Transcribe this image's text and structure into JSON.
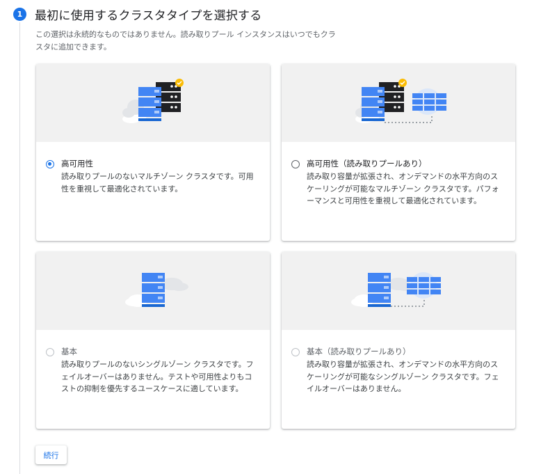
{
  "step": {
    "number": "1",
    "title": "最初に使用するクラスタタイプを選択する",
    "description": "この選択は永続的なものではありません。読み取りプール インスタンスはいつでもクラスタに追加できます。"
  },
  "options": [
    {
      "title": "高可用性",
      "description": "読み取りプールのないマルチゾーン クラスタです。可用性を重視して最適化されています。",
      "selected": true,
      "illustration": "multi-zone-cluster"
    },
    {
      "title": "高可用性（読み取りプールあり）",
      "description": "読み取り容量が拡張され、オンデマンドの水平方向のスケーリングが可能なマルチゾーン クラスタです。パフォーマンスと可用性を重視して最適化されています。",
      "selected": false,
      "illustration": "multi-zone-cluster-with-read-pool"
    },
    {
      "title": "基本",
      "description": "読み取りプールのないシングルゾーン クラスタです。フェイルオーバーはありません。テストや可用性よりもコストの抑制を優先するユースケースに適しています。",
      "selected": false,
      "illustration": "single-zone-cluster"
    },
    {
      "title": "基本（読み取りプールあり）",
      "description": "読み取り容量が拡張され、オンデマンドの水平方向のスケーリングが可能なシングルゾーン クラスタです。フェイルオーバーはありません。",
      "selected": false,
      "illustration": "single-zone-cluster-with-read-pool"
    }
  ],
  "actions": {
    "continue_label": "続行"
  },
  "colors": {
    "accent": "#1a73e8",
    "server_blue": "#4285f4",
    "server_dark": "#202124",
    "check_yellow": "#fbbc04",
    "cloud": "#dadce0"
  }
}
